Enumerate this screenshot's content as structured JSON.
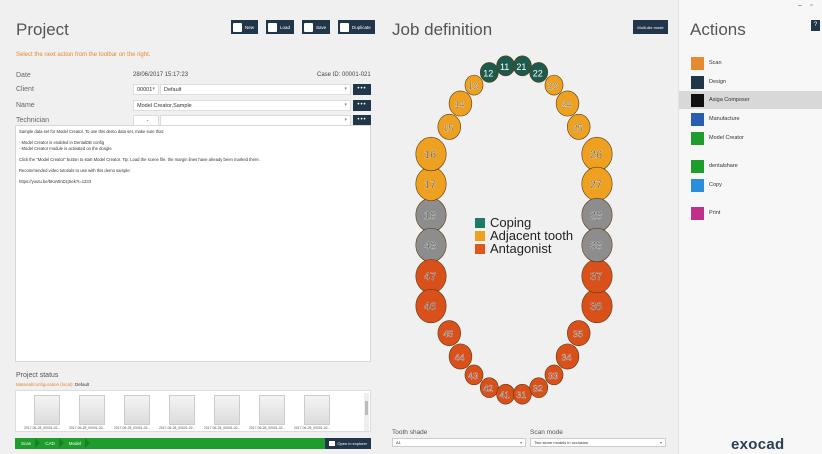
{
  "project": {
    "title": "Project",
    "toolbar": {
      "new": "New",
      "load": "Load",
      "save": "Save",
      "duplicate": "Duplicate"
    },
    "hint": "Select the next action from the toolbar on the right.",
    "date_label": "Date",
    "date_value": "28/06/2017 15:17:23",
    "case_id": "Case ID: 00001-021",
    "client_label": "Client",
    "client_code": "00001",
    "client_name": "Default",
    "name_label": "Name",
    "name_value": "Model Creator,Sample",
    "technician_label": "Technician",
    "technician_code": "-",
    "technician_name": "",
    "more_label": "•••",
    "notes": [
      "Sample data set for Model Creator. To use this demo data set, make sure that:",
      "",
      "- Model Creator is enabled in DentalDB config",
      "- Model Creator module is activated on the dongle",
      "",
      "Click the \"Model Creator\" button to start Model Creator. Tip: Load the scene file, the margin lines have already been marked there.",
      "",
      "Recommended video tutorials to use with this demo sample:",
      "",
      "https://youtu.be/bKoWnDzjSek?t=1333"
    ],
    "status_title": "Project status",
    "status_sub_label": "Material/configuration (local):",
    "status_sub_value": "Default",
    "thumbnails": [
      "2017-06-28_00001-02...",
      "2017-06-28_00001-02...",
      "2017-06-28_00001-02...",
      "2017-06-28_00001-02...",
      "2017-06-28_00001-02...",
      "2017-06-28_00001-02...",
      "2017-06-28_00001-02..."
    ],
    "workflow": [
      "Scan",
      "CAD",
      "Model"
    ],
    "open_explorer": "Open in explorer"
  },
  "job": {
    "title": "Job definition",
    "multi_die": "Multi-die mode",
    "teeth_upper": [
      {
        "n": "18",
        "type": "none"
      },
      {
        "n": "17",
        "type": "adjacent"
      },
      {
        "n": "16",
        "type": "adjacent"
      },
      {
        "n": "15",
        "type": "adjacent"
      },
      {
        "n": "14",
        "type": "adjacent"
      },
      {
        "n": "13",
        "type": "adjacent"
      },
      {
        "n": "12",
        "type": "coping"
      },
      {
        "n": "11",
        "type": "coping"
      },
      {
        "n": "21",
        "type": "coping"
      },
      {
        "n": "22",
        "type": "coping"
      },
      {
        "n": "23",
        "type": "adjacent"
      },
      {
        "n": "24",
        "type": "adjacent"
      },
      {
        "n": "25",
        "type": "adjacent"
      },
      {
        "n": "26",
        "type": "adjacent"
      },
      {
        "n": "27",
        "type": "adjacent"
      },
      {
        "n": "28",
        "type": "none"
      }
    ],
    "teeth_lower": [
      {
        "n": "48",
        "type": "none"
      },
      {
        "n": "47",
        "type": "antagonist"
      },
      {
        "n": "46",
        "type": "antagonist"
      },
      {
        "n": "45",
        "type": "antagonist"
      },
      {
        "n": "44",
        "type": "antagonist"
      },
      {
        "n": "43",
        "type": "antagonist"
      },
      {
        "n": "42",
        "type": "antagonist"
      },
      {
        "n": "41",
        "type": "antagonist"
      },
      {
        "n": "31",
        "type": "antagonist"
      },
      {
        "n": "32",
        "type": "antagonist"
      },
      {
        "n": "33",
        "type": "antagonist"
      },
      {
        "n": "34",
        "type": "antagonist"
      },
      {
        "n": "35",
        "type": "antagonist"
      },
      {
        "n": "36",
        "type": "antagonist"
      },
      {
        "n": "37",
        "type": "antagonist"
      },
      {
        "n": "38",
        "type": "none"
      }
    ],
    "colors": {
      "coping": "#1e5a4c",
      "adjacent": "#eea020",
      "antagonist": "#d9501a",
      "none": "#8d8d8d"
    },
    "legend": [
      {
        "label": "Coping",
        "color": "#1e7a64"
      },
      {
        "label": "Adjacent tooth",
        "color": "#eea020"
      },
      {
        "label": "Antagonist",
        "color": "#e0561a"
      }
    ],
    "tooth_shade_label": "Tooth shade",
    "tooth_shade_value": "A1",
    "scan_mode_label": "Scan mode",
    "scan_mode_value": "Two stone models in occlusion"
  },
  "actions": {
    "title": "Actions",
    "help": "?",
    "minimize": "–",
    "maximize": "▫",
    "items": [
      {
        "label": "Scan",
        "icon": "scan-icon",
        "color": "#e58a2f"
      },
      {
        "label": "Design",
        "icon": "design-icon",
        "color": "#22364a"
      },
      {
        "label": "Asiga Composer",
        "icon": "asiga-icon",
        "color": "#111111"
      },
      {
        "label": "Manufacture",
        "icon": "manufacture-icon",
        "color": "#2a5fb0"
      },
      {
        "label": "Model Creator",
        "icon": "model-creator-icon",
        "color": "#1e9c2c"
      },
      {
        "label": "dentalshare",
        "icon": "dentalshare-icon",
        "color": "#1e9c2c"
      },
      {
        "label": "Copy",
        "icon": "copy-icon",
        "color": "#2a8fd8"
      },
      {
        "label": "Print",
        "icon": "print-icon",
        "color": "#c0308a"
      }
    ],
    "brand": "exocad"
  }
}
